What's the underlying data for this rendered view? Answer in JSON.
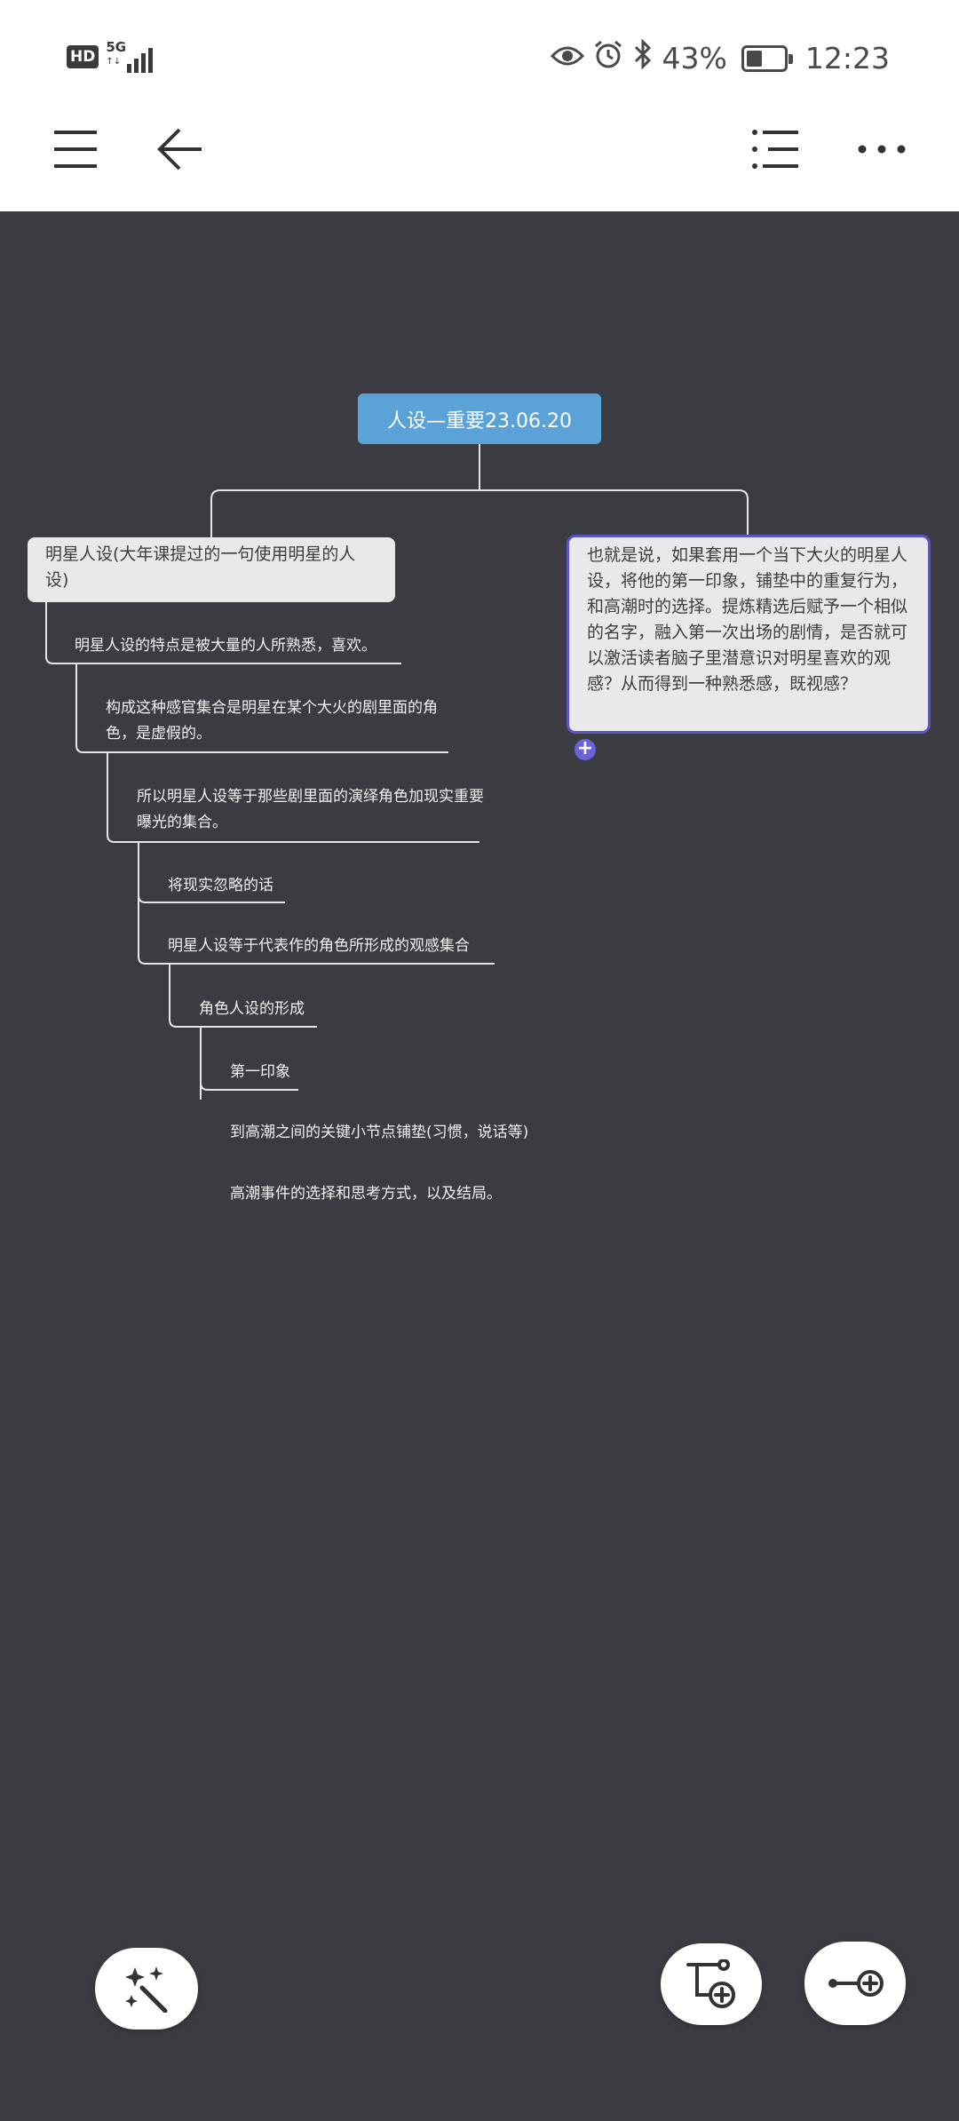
{
  "status_bar": {
    "hd": "HD",
    "network": "5G",
    "network_sub": "↑↓",
    "battery_percent": "43%",
    "battery_level": 0.43,
    "time": "12:23",
    "icons": [
      "eye-icon",
      "alarm-icon",
      "bluetooth-icon",
      "battery-icon"
    ]
  },
  "toolbar": {
    "icons": [
      "menu-icon",
      "back-arrow-icon",
      "outline-list-icon",
      "more-icon"
    ]
  },
  "mindmap": {
    "root": "人设—重要23.06.20",
    "left_topic": "明星人设(大年课提过的一句使用明星的人设)",
    "right_topic": "也就是说，如果套用一个当下大火的明星人设，将他的第一印象，铺垫中的重复行为，和高潮时的选择。提炼精选后赋予一个相似的名字，融入第一次出场的剧情，是否就可以激活读者脑子里潜意识对明星喜欢的观感？从而得到一种熟悉感，既视感？",
    "add_button": "+",
    "subtopics": [
      "明星人设的特点是被大量的人所熟悉，喜欢。",
      "构成这种感官集合是明星在某个大火的剧里面的角色，是虚假的。",
      "所以明星人设等于那些剧里面的演绎角色加现实重要曝光的集合。",
      "将现实忽略的话",
      "明星人设等于代表作的角色所形成的观感集合",
      "角色人设的形成",
      "第一印象",
      "到高潮之间的关键小节点铺垫(习惯，说话等)",
      "高潮事件的选择和思考方式，以及结局。"
    ]
  },
  "colors": {
    "canvas": "#3b3c42",
    "root": "#5aa2d8",
    "accent": "#5b55c8",
    "topic_bg": "#e9e9eb"
  },
  "floating_buttons": [
    "magic-wand-icon",
    "add-subtopic-icon",
    "add-relation-icon"
  ]
}
